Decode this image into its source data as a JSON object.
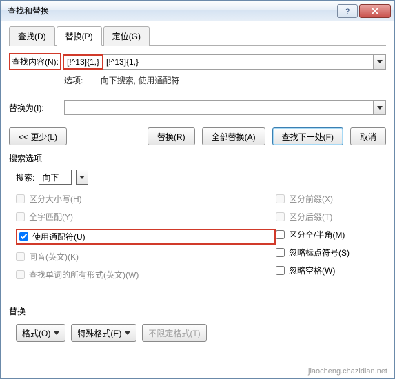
{
  "title": "查找和替换",
  "tabs": {
    "find": "查找(D)",
    "replace": "替换(P)",
    "goto": "定位(G)"
  },
  "find_section": {
    "label": "查找内容(N):",
    "value": "[!^13]{1,}",
    "options_label": "选项:",
    "options_text": "向下搜索, 使用通配符"
  },
  "replace_section": {
    "label": "替换为(I):",
    "value": ""
  },
  "buttons": {
    "less": "<< 更少(L)",
    "replace": "替换(R)",
    "replace_all": "全部替换(A)",
    "find_next": "查找下一处(F)",
    "cancel": "取消"
  },
  "search_options": {
    "group_label": "搜索选项",
    "direction_label": "搜索:",
    "direction_value": "向下",
    "left": {
      "match_case": "区分大小写(H)",
      "whole_word": "全字匹配(Y)",
      "wildcards": "使用通配符(U)",
      "sounds_like": "同音(英文)(K)",
      "all_forms": "查找单词的所有形式(英文)(W)"
    },
    "right": {
      "prefix": "区分前缀(X)",
      "suffix": "区分后缀(T)",
      "full_half": "区分全/半角(M)",
      "ignore_punct": "忽略标点符号(S)",
      "ignore_space": "忽略空格(W)"
    }
  },
  "replace_group": {
    "label": "替换",
    "format_btn": "格式(O)",
    "special_btn": "特殊格式(E)",
    "no_format_btn": "不限定格式(T)"
  },
  "watermark": "jiaocheng.chazidian.net"
}
